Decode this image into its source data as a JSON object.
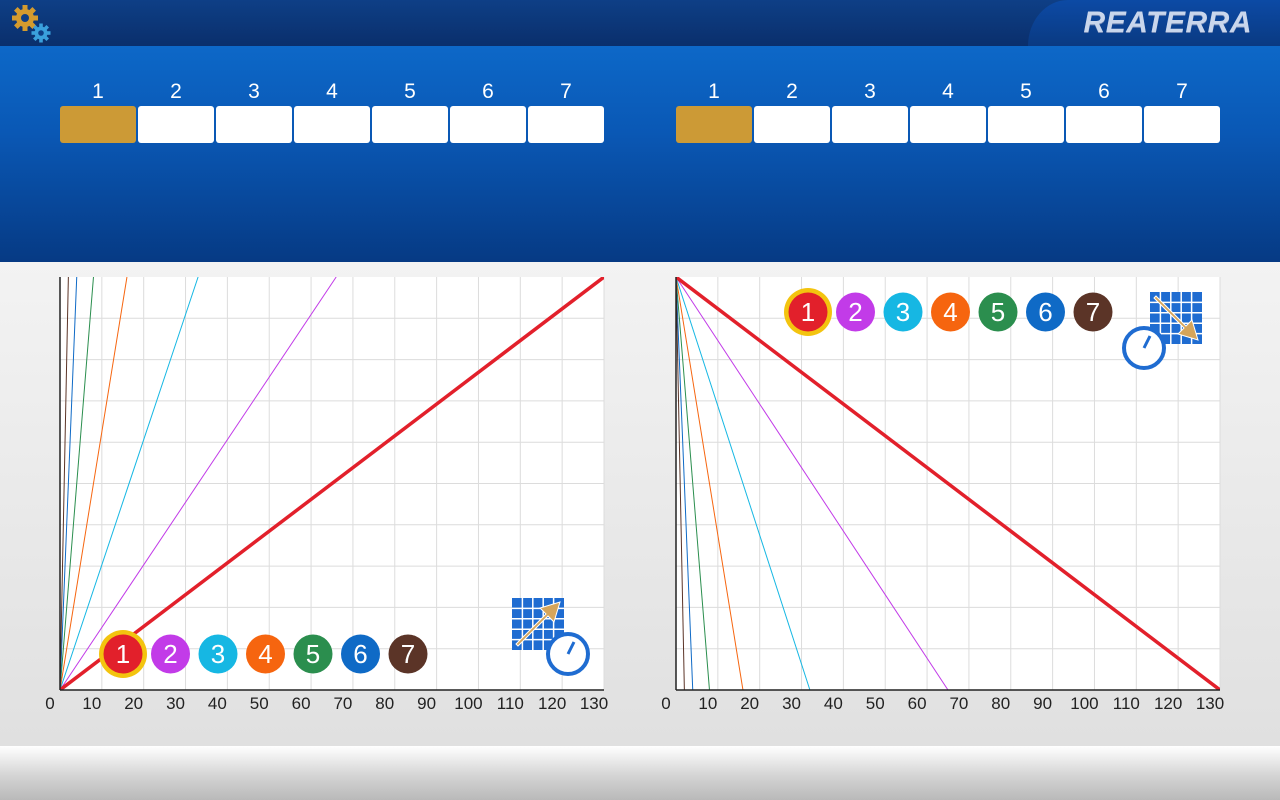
{
  "app": {
    "brand": "REATERRA"
  },
  "toolbar": {
    "settings_icon": "gears-icon"
  },
  "selectors": [
    {
      "group": "left",
      "numbers": [
        "1",
        "2",
        "3",
        "4",
        "5",
        "6",
        "7"
      ],
      "active_index": 0
    },
    {
      "group": "right",
      "numbers": [
        "1",
        "2",
        "3",
        "4",
        "5",
        "6",
        "7"
      ],
      "active_index": 0
    }
  ],
  "colors": {
    "selector_active": "#cc9a36",
    "selector_inactive": "#ffffff",
    "series": [
      "#e2202b",
      "#c23be8",
      "#16b7e3",
      "#f6650f",
      "#2b8e4e",
      "#0f6ac6",
      "#5b3427"
    ],
    "legend_selected_ring": "#f3c40f"
  },
  "legend_labels": [
    "1",
    "2",
    "3",
    "4",
    "5",
    "6",
    "7"
  ],
  "chart_data": [
    {
      "type": "line",
      "mode": "increasing",
      "icon": "grid-arrow-up-stopwatch-icon",
      "title": "",
      "xlabel": "",
      "ylabel": "",
      "x_ticks": [
        "0",
        "10",
        "20",
        "30",
        "40",
        "50",
        "60",
        "70",
        "80",
        "90",
        "100",
        "110",
        "120",
        "130"
      ],
      "xlim": [
        0,
        130
      ],
      "ylim": [
        0,
        1
      ],
      "grid": true,
      "legend_position": "bottom",
      "selected_series": "1",
      "series": [
        {
          "label": "1",
          "x": [
            0,
            130
          ],
          "y": [
            0,
            1
          ],
          "emphasized": true
        },
        {
          "label": "2",
          "x": [
            0,
            66
          ],
          "y": [
            0,
            1
          ]
        },
        {
          "label": "3",
          "x": [
            0,
            33
          ],
          "y": [
            0,
            1
          ]
        },
        {
          "label": "4",
          "x": [
            0,
            16
          ],
          "y": [
            0,
            1
          ]
        },
        {
          "label": "5",
          "x": [
            0,
            8
          ],
          "y": [
            0,
            1
          ]
        },
        {
          "label": "6",
          "x": [
            0,
            4
          ],
          "y": [
            0,
            1
          ]
        },
        {
          "label": "7",
          "x": [
            0,
            2
          ],
          "y": [
            0,
            1
          ]
        }
      ]
    },
    {
      "type": "line",
      "mode": "decreasing",
      "icon": "grid-arrow-down-stopwatch-icon",
      "title": "",
      "xlabel": "",
      "ylabel": "",
      "x_ticks": [
        "0",
        "10",
        "20",
        "30",
        "40",
        "50",
        "60",
        "70",
        "80",
        "90",
        "100",
        "110",
        "120",
        "130"
      ],
      "xlim": [
        0,
        130
      ],
      "ylim": [
        0,
        1
      ],
      "grid": true,
      "legend_position": "top",
      "selected_series": "1",
      "series": [
        {
          "label": "1",
          "x": [
            0,
            130
          ],
          "y": [
            1,
            0
          ],
          "emphasized": true
        },
        {
          "label": "2",
          "x": [
            0,
            65
          ],
          "y": [
            1,
            0
          ]
        },
        {
          "label": "3",
          "x": [
            0,
            32
          ],
          "y": [
            1,
            0
          ]
        },
        {
          "label": "4",
          "x": [
            0,
            16
          ],
          "y": [
            1,
            0
          ]
        },
        {
          "label": "5",
          "x": [
            0,
            8
          ],
          "y": [
            1,
            0
          ]
        },
        {
          "label": "6",
          "x": [
            0,
            4
          ],
          "y": [
            1,
            0
          ]
        },
        {
          "label": "7",
          "x": [
            0,
            2
          ],
          "y": [
            1,
            0
          ]
        }
      ]
    }
  ]
}
